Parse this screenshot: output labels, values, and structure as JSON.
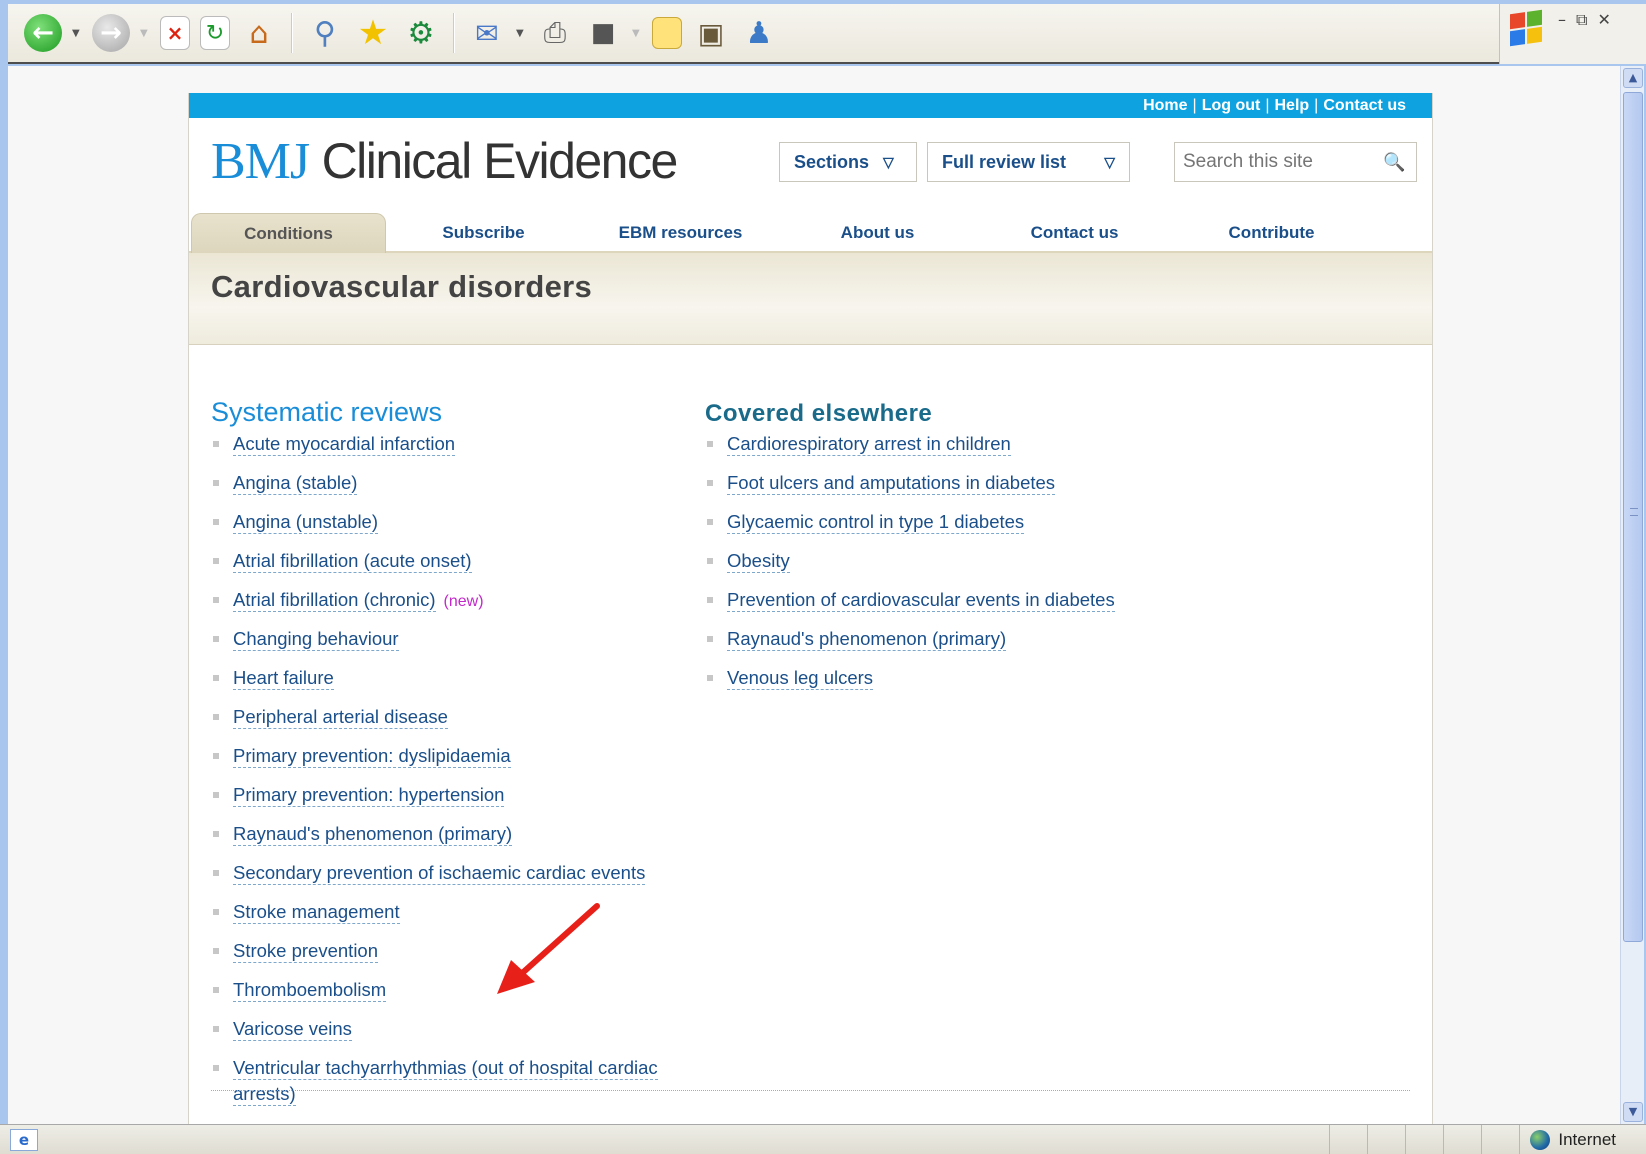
{
  "toolbar": {
    "icons": [
      "back-icon",
      "forward-icon",
      "stop-icon",
      "refresh-icon",
      "home-icon",
      "search-icon",
      "favorites-icon",
      "media-icon",
      "mail-icon",
      "print-icon",
      "edit-icon",
      "notes-icon",
      "research-icon",
      "messenger-icon"
    ]
  },
  "utility_links": [
    "Home",
    "Log out",
    "Help",
    "Contact us"
  ],
  "logo": {
    "bmj": "BMJ",
    "name": "Clinical Evidence"
  },
  "header": {
    "sections_label": "Sections",
    "full_review_label": "Full review list",
    "search_placeholder": "Search this site"
  },
  "nav": {
    "tabs": [
      "Conditions",
      "Subscribe",
      "EBM resources",
      "About us",
      "Contact us",
      "Contribute"
    ],
    "active": "Conditions"
  },
  "page_title": "Cardiovascular disorders",
  "systematic_reviews": {
    "heading": "Systematic reviews",
    "items": [
      "Acute myocardial infarction",
      "Angina (stable)",
      "Angina (unstable)",
      "Atrial fibrillation (acute onset)",
      "Atrial fibrillation (chronic)",
      "Changing behaviour",
      "Heart failure",
      "Peripheral arterial disease",
      "Primary prevention: dyslipidaemia",
      "Primary prevention: hypertension",
      "Raynaud's phenomenon (primary)",
      "Secondary prevention of ischaemic cardiac events",
      "Stroke management",
      "Stroke prevention",
      "Thromboembolism",
      "Varicose veins",
      "Ventricular tachyarrhythmias (out of hospital cardiac arrests)"
    ],
    "new_tag": "(new)"
  },
  "covered_elsewhere": {
    "heading": "Covered elsewhere",
    "items": [
      "Cardiorespiratory arrest in children",
      "Foot ulcers and amputations in diabetes",
      "Glycaemic control in type 1 diabetes",
      "Obesity",
      "Prevention of cardiovascular events in diabetes",
      "Raynaud's phenomenon (primary)",
      "Venous leg ulcers"
    ]
  },
  "status": {
    "zone": "Internet"
  },
  "colors": {
    "util_bar": "#0ea3e0",
    "link": "#1a4f8a",
    "heading_blue": "#1a8dd8",
    "new_tag": "#c229c9",
    "annotation_arrow": "#e8201a"
  }
}
